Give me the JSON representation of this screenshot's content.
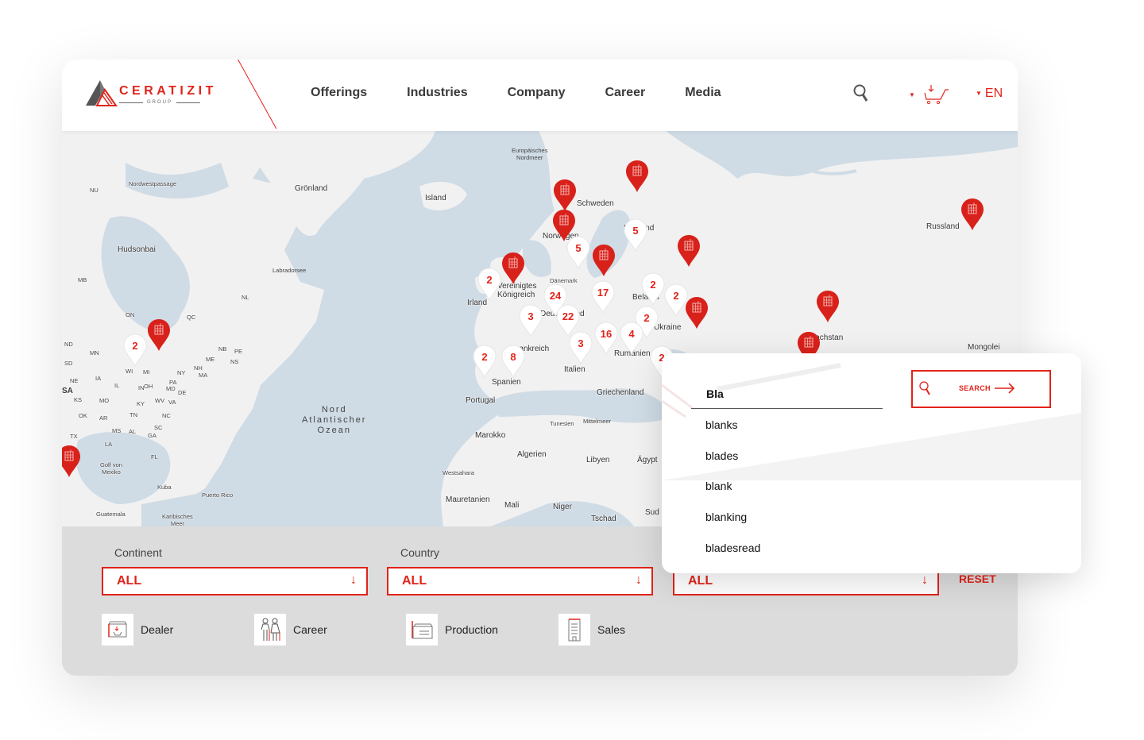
{
  "brand": {
    "name": "CERATIZIT",
    "subtitle": "GROUP",
    "accent_color": "#e2231a"
  },
  "nav": {
    "items": [
      {
        "label": "Offerings"
      },
      {
        "label": "Industries"
      },
      {
        "label": "Company"
      },
      {
        "label": "Career"
      },
      {
        "label": "Media"
      }
    ],
    "search_icon": "search-icon",
    "cart_icon": "cart-icon",
    "language": "EN"
  },
  "map": {
    "labels": [
      {
        "text": "Europäisches\nNordmeer",
        "kind": "sea"
      },
      {
        "text": "Nordwestpassage"
      },
      {
        "text": "Grönland"
      },
      {
        "text": "Island"
      },
      {
        "text": "Schweden"
      },
      {
        "text": "NU"
      },
      {
        "text": "Hudsonbai"
      },
      {
        "text": "Labradorsee"
      },
      {
        "text": "MB"
      },
      {
        "text": "NL"
      },
      {
        "text": "ON"
      },
      {
        "text": "QC"
      },
      {
        "text": "Norwegen"
      },
      {
        "text": "Finnland"
      },
      {
        "text": "Russland"
      },
      {
        "text": "Dänemark"
      },
      {
        "text": "Vereinigtes Königreich"
      },
      {
        "text": "Irland"
      },
      {
        "text": "Deutschland"
      },
      {
        "text": "Belarus"
      },
      {
        "text": "Ukraine"
      },
      {
        "text": "Frankreich"
      },
      {
        "text": "Rumänien"
      },
      {
        "text": "Italien"
      },
      {
        "text": "Spanien"
      },
      {
        "text": "Portugal"
      },
      {
        "text": "Griechenland"
      },
      {
        "text": "Tunesien"
      },
      {
        "text": "Mittelmeer"
      },
      {
        "text": "Marokko"
      },
      {
        "text": "Algerien"
      },
      {
        "text": "Libyen"
      },
      {
        "text": "Ägypten"
      },
      {
        "text": "Westsahara"
      },
      {
        "text": "Mauretanien"
      },
      {
        "text": "Mali"
      },
      {
        "text": "Niger"
      },
      {
        "text": "Tschad"
      },
      {
        "text": "Sudan"
      },
      {
        "text": "Kasachstan"
      },
      {
        "text": "Mongolei"
      },
      {
        "text": "Nord Atlantischer Ozean"
      },
      {
        "text": "Golf von Mexiko"
      },
      {
        "text": "Kuba"
      },
      {
        "text": "Puerto Rico"
      },
      {
        "text": "Guatemala"
      },
      {
        "text": "Karibisches Meer"
      },
      {
        "text": "USA"
      }
    ],
    "us_states": [
      "ND",
      "MN",
      "SD",
      "WI",
      "MI",
      "NE",
      "IA",
      "IL",
      "IN",
      "OH",
      "PA",
      "NY",
      "KS",
      "MO",
      "KY",
      "WV",
      "MD",
      "DE",
      "VA",
      "OK",
      "AR",
      "TN",
      "NC",
      "MS",
      "AL",
      "GA",
      "SC",
      "TX",
      "LA",
      "FL",
      "NH",
      "MA",
      "ME",
      "NB",
      "PE",
      "NS"
    ],
    "cluster_pins": [
      "2",
      "2",
      "5",
      "5",
      "24",
      "17",
      "2",
      "2",
      "3",
      "22",
      "2",
      "16",
      "4",
      "3",
      "2",
      "8",
      "2"
    ],
    "location_pins": 12
  },
  "filters": {
    "continent": {
      "label": "Continent",
      "value": "ALL"
    },
    "country": {
      "label": "Country",
      "value": "ALL"
    },
    "third": {
      "value": "ALL"
    },
    "reset_label": "RESET",
    "legend": [
      {
        "label": "Dealer",
        "icon": "dealer-icon"
      },
      {
        "label": "Career",
        "icon": "career-icon"
      },
      {
        "label": "Production",
        "icon": "production-icon"
      },
      {
        "label": "Sales",
        "icon": "sales-icon"
      }
    ]
  },
  "search_popup": {
    "query": "Bla",
    "button_label": "SEARCH",
    "suggestions": [
      "blanks",
      "blades",
      "blank",
      "blanking",
      "bladesread"
    ]
  }
}
